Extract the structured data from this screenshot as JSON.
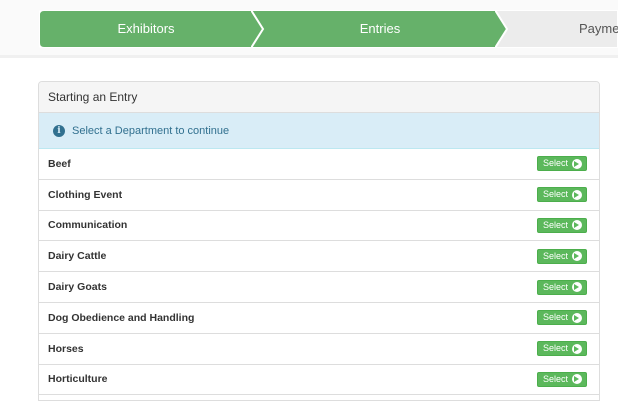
{
  "wizard": {
    "steps": [
      {
        "label": "Exhibitors",
        "state": "complete"
      },
      {
        "label": "Entries",
        "state": "active"
      },
      {
        "label": "Payment",
        "state": "pending"
      }
    ],
    "colors": {
      "complete": "#66b16a",
      "pending": "#ececec",
      "pending_text": "#555555"
    }
  },
  "panel": {
    "heading": "Starting an Entry",
    "info": {
      "icon": "info-circle-icon",
      "text": "Select a Department to continue"
    },
    "departments": [
      {
        "name": "Beef",
        "button": "Select"
      },
      {
        "name": "Clothing Event",
        "button": "Select"
      },
      {
        "name": "Communication",
        "button": "Select"
      },
      {
        "name": "Dairy Cattle",
        "button": "Select"
      },
      {
        "name": "Dairy Goats",
        "button": "Select"
      },
      {
        "name": "Dog Obedience and Handling",
        "button": "Select"
      },
      {
        "name": "Horses",
        "button": "Select"
      },
      {
        "name": "Horticulture",
        "button": "Select"
      }
    ],
    "button_icon": "arrow-circle-right-icon",
    "button_color": "#5cb85c"
  }
}
